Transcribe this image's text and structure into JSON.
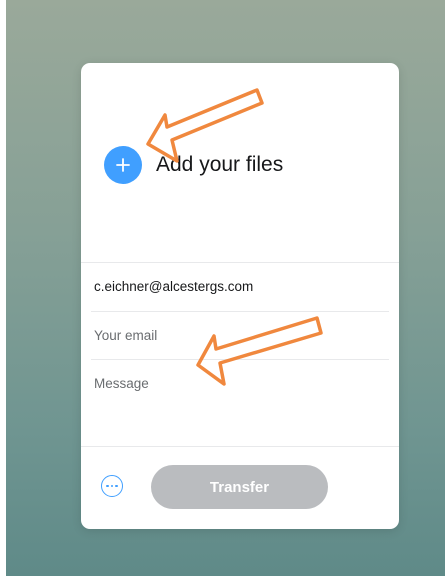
{
  "upload": {
    "add_files_label": "Add your files"
  },
  "form": {
    "recipient_value": "c.eichner@alcestergs.com",
    "email_placeholder": "Your email",
    "message_placeholder": "Message"
  },
  "footer": {
    "transfer_label": "Transfer"
  },
  "colors": {
    "accent": "#409fff",
    "transfer_disabled": "#babcbf",
    "annotation_arrow": "#f0883e"
  },
  "icons": {
    "add": "plus-icon",
    "options": "more-options-icon",
    "annotation": "arrow-icon"
  }
}
